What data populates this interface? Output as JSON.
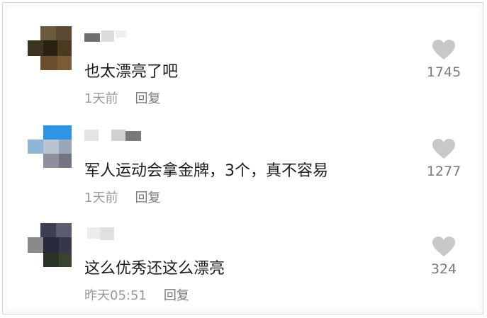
{
  "comments": [
    {
      "text": "也太漂亮了吧",
      "time": "1天前",
      "reply_label": "回复",
      "likes": "1745"
    },
    {
      "text": "军人运动会拿金牌，3个，真不容易",
      "time": "1天前",
      "reply_label": "回复",
      "likes": "1277"
    },
    {
      "text": "这么优秀还这么漂亮",
      "time": "昨天05:51",
      "reply_label": "回复",
      "likes": "324"
    }
  ],
  "icons": {
    "like": "heart-icon"
  },
  "colors": {
    "text": "#1c1c1c",
    "meta": "#9a9a9a",
    "heart": "#c8c8c8"
  }
}
